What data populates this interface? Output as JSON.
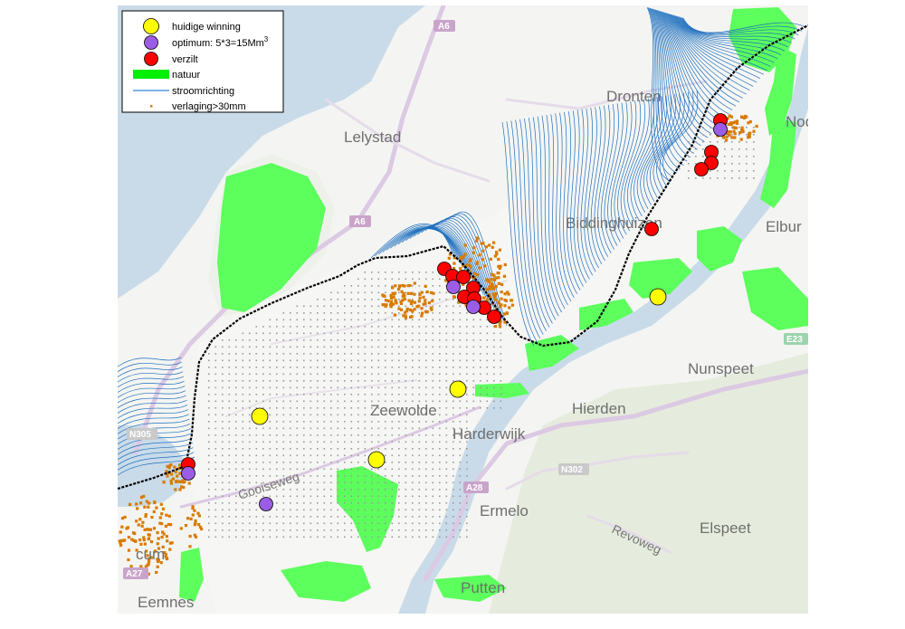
{
  "legend": {
    "items": [
      {
        "label": "huidige winning",
        "color": "#ffff00",
        "symbol": "circle"
      },
      {
        "label": "optimum: 5*3=15Mm",
        "superscript": "3",
        "color": "#9b5de5",
        "symbol": "circle"
      },
      {
        "label": "verzilt",
        "color": "#ff0000",
        "symbol": "circle"
      },
      {
        "label": "natuur",
        "color": "#00ee00",
        "symbol": "patch"
      },
      {
        "label": "stroomrichting",
        "color": "#0066cc",
        "symbol": "line"
      },
      {
        "label": "verlaging>30mm",
        "color": "#d97b00",
        "symbol": "dot"
      }
    ]
  },
  "places": {
    "lelystad": "Lelystad",
    "dronten": "Dronten",
    "biddinghuizen": "Biddinghuizen",
    "elburg": "Elbur",
    "nunspeet": "Nunspeet",
    "hierden": "Hierden",
    "zeewolde": "Zeewolde",
    "harderwijk": "Harderwijk",
    "ermelo": "Ermelo",
    "elspeet": "Elspeet",
    "putten": "Putten",
    "eemnes": "Eemnes",
    "cum": "cum",
    "nod": "Nod",
    "gooiseweg": "Gooiseweg",
    "revoweg": "Revoweg"
  },
  "roads": {
    "a6_top": "A6",
    "a6_mid": "A6",
    "a28": "A28",
    "a27": "A27",
    "n302": "N302",
    "e232": "E23",
    "n305": "N305"
  },
  "colors": {
    "land": "#f4f5f2",
    "water": "#c9dbe9",
    "polder": "#f6f6f4",
    "forest": "#e6ecdd",
    "nature": "#5cff5c",
    "flow": "#1e6fbf",
    "dike": "#000000",
    "drawdown": "#d97b00",
    "grid": "#9a9a9a",
    "current": "#ffff00",
    "optimum": "#9b5de5",
    "salinated": "#ff0000",
    "road": "#d8c7e0",
    "highway": "#e0cfe6"
  },
  "wells": {
    "huidige_winning": 5,
    "optimum": 4,
    "verzilt": 20
  }
}
